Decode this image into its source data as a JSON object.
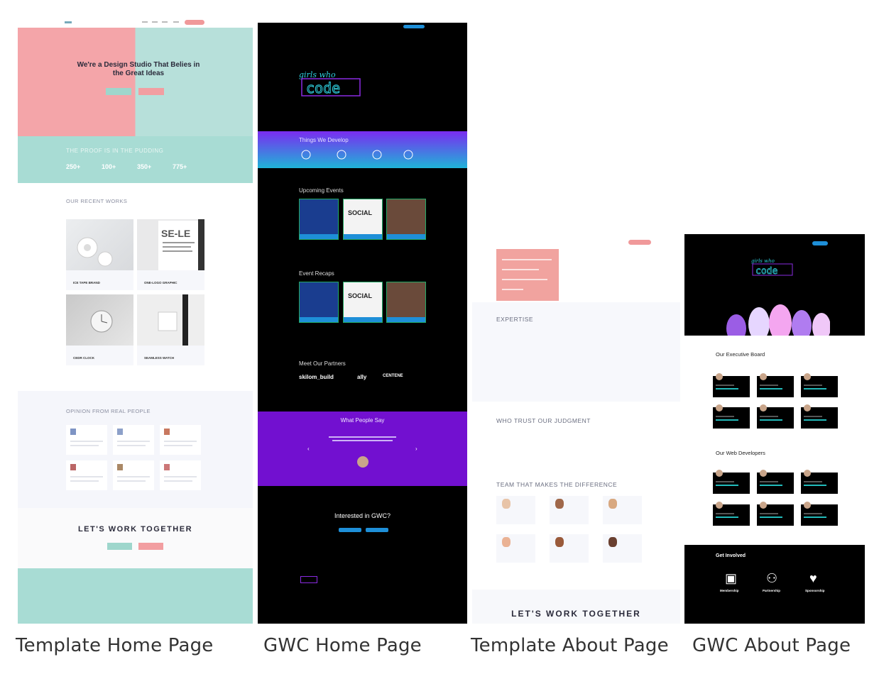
{
  "captions": {
    "template_home": "Template Home Page",
    "gwc_home": "GWC Home Page",
    "template_about": "Template About Page",
    "gwc_about": "GWC About Page"
  },
  "template_home": {
    "hero_title": "We're a Design Studio That Belies in the Great Ideas",
    "proof_heading": "THE PROOF IS IN THE PUDDING",
    "stats": [
      "250+",
      "100+",
      "350+",
      "775+"
    ],
    "recent_works_heading": "OUR RECENT WORKS",
    "works": [
      {
        "name": "ICE TAPE BRAND"
      },
      {
        "name": "ONE-LOGO GRAPHIC"
      },
      {
        "name": "CEDR CLOCK"
      },
      {
        "name": "SEAMLESS WATCH"
      }
    ],
    "opinion_heading": "OPINION FROM REAL PEOPLE",
    "cta_heading": "LET'S WORK TOGETHER"
  },
  "gwc_home": {
    "logo_text": "code",
    "things_heading": "Things We Develop",
    "upcoming_heading": "Upcoming Events",
    "recaps_heading": "Event Recaps",
    "social_label": "SOCIAL",
    "partners_heading": "Meet Our Partners",
    "partners": [
      "skilom_build",
      "ally",
      "CENTENE"
    ],
    "quote_heading": "What People Say",
    "interest_heading": "Interested in GWC?"
  },
  "template_about": {
    "expertise_heading": "EXPERTISE",
    "trust_heading": "WHO TRUST OUR JUDGMENT",
    "team_heading": "TEAM THAT MAKES THE DIFFERENCE",
    "cta_heading": "LET'S WORK TOGETHER"
  },
  "gwc_about": {
    "logo_text": "code",
    "board_heading": "Our Executive Board",
    "devs_heading": "Our Web Developers",
    "involved_heading": "Get Involved",
    "involved_items": [
      "Membership",
      "Partnership",
      "Sponsorship"
    ]
  },
  "colors": {
    "pink": "#f4a5a9",
    "mint": "#a8dcd4",
    "purple": "#7210d0",
    "blue": "#1e8fd8"
  }
}
